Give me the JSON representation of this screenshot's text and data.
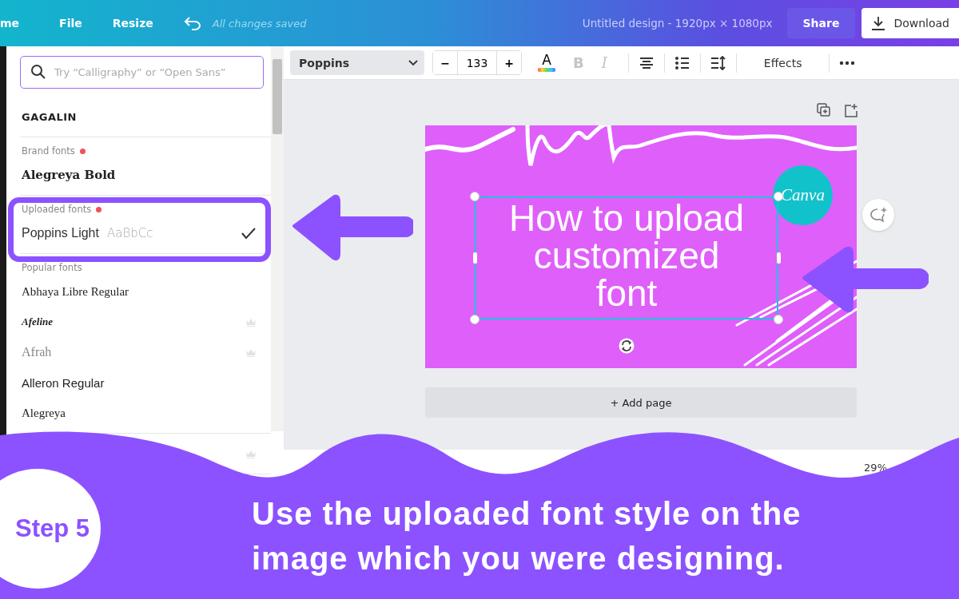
{
  "top_bar": {
    "menu": [
      {
        "label": "me"
      },
      {
        "label": "File"
      },
      {
        "label": "Resize"
      }
    ],
    "status": "All changes saved",
    "title": "Untitled design - 1920px × 1080px",
    "share": "Share",
    "download": "Download"
  },
  "font_panel": {
    "search": {
      "placeholder": "Try “Calligraphy” or “Open Sans”"
    },
    "sections": [
      {
        "items": [
          {
            "label": "GAGALIN",
            "kind": "display",
            "checked": false,
            "premium": false
          }
        ]
      },
      {
        "heading": "Brand fonts",
        "new": true,
        "items": [
          {
            "label": "Alegreya Bold",
            "kind": "serif-bold",
            "checked": false,
            "premium": false
          }
        ]
      },
      {
        "heading": "Uploaded fonts",
        "new": true,
        "items": [
          {
            "label": "Poppins Light",
            "sample": "AaBbCc",
            "kind": "sans-light",
            "checked": true,
            "premium": false
          }
        ]
      },
      {
        "heading": "Popular fonts",
        "new": false,
        "items": [
          {
            "label": "Abhaya Libre Regular",
            "kind": "serif",
            "checked": false,
            "premium": false
          },
          {
            "label": "Afeline",
            "kind": "script",
            "checked": false,
            "premium": true
          },
          {
            "label": "Afrah",
            "kind": "serif-light",
            "checked": false,
            "premium": true
          },
          {
            "label": "Alleron Regular",
            "kind": "sans",
            "checked": false,
            "premium": false
          },
          {
            "label": "Alegreya",
            "kind": "serif",
            "checked": false,
            "premium": false
          }
        ]
      },
      {
        "items": [
          {
            "checked": false,
            "premium": true
          }
        ]
      }
    ]
  },
  "toolbar": {
    "font": "Poppins",
    "minus": "−",
    "size": "133",
    "plus": "+",
    "color_label": "A",
    "format_buttons": [
      {
        "label": "B",
        "kind": "bold",
        "disabled": true
      },
      {
        "label": "I",
        "kind": "italic",
        "disabled": true
      }
    ],
    "effects": "Effects"
  },
  "design": {
    "lines": [
      "How to upload",
      "customized",
      "font"
    ],
    "logo": "Canva"
  },
  "add_page": "+ Add page",
  "zoom": "29%",
  "overlay": {
    "step": "Step 5",
    "caption": "Use the uploaded font style on the image which you were designing."
  }
}
